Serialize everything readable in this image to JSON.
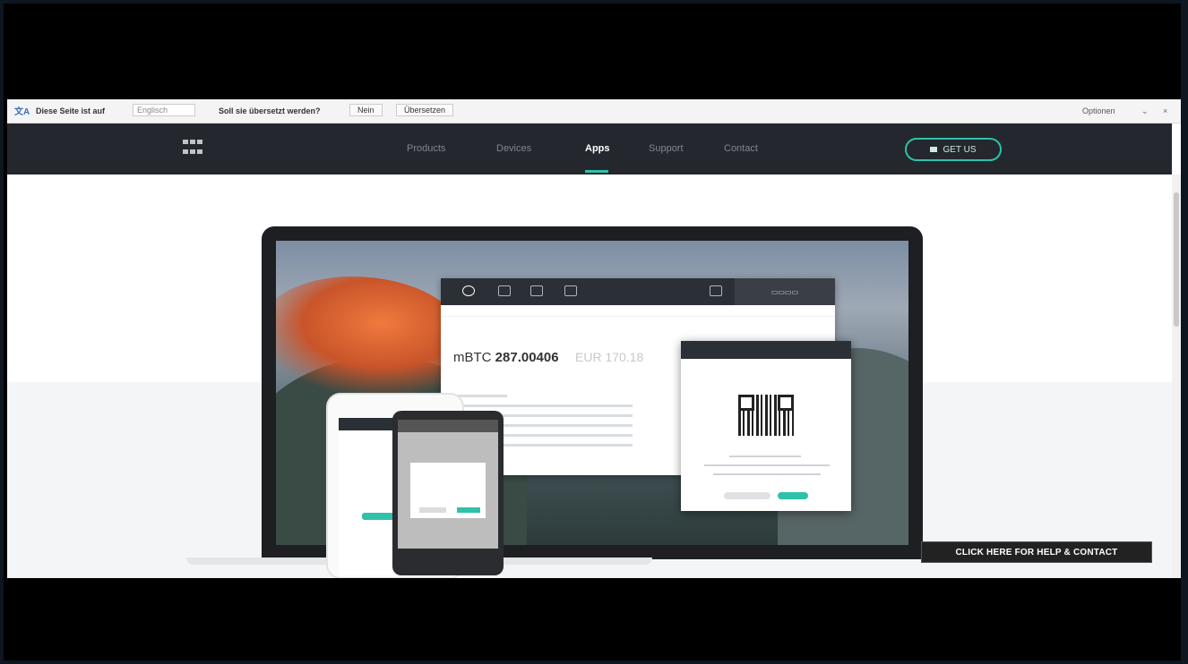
{
  "translate_bar": {
    "page_language_text": "Diese Seite ist auf",
    "language": "Englisch",
    "question": "Soll sie übersetzt werden?",
    "no_button": "Nein",
    "translate_button": "Übersetzen",
    "options": "Optionen"
  },
  "nav": {
    "items": [
      "Products",
      "Devices",
      "Apps",
      "Support",
      "Contact"
    ],
    "active": "Apps",
    "cta_label": "GET US"
  },
  "wallet": {
    "btc_unit": "mBTC",
    "btc_amount": "287.00406",
    "fiat_amount": "EUR 170.18"
  },
  "help_button": "CLICK HERE FOR HELP & CONTACT",
  "colors": {
    "accent": "#2fc1a9",
    "navbar": "#24282e"
  }
}
